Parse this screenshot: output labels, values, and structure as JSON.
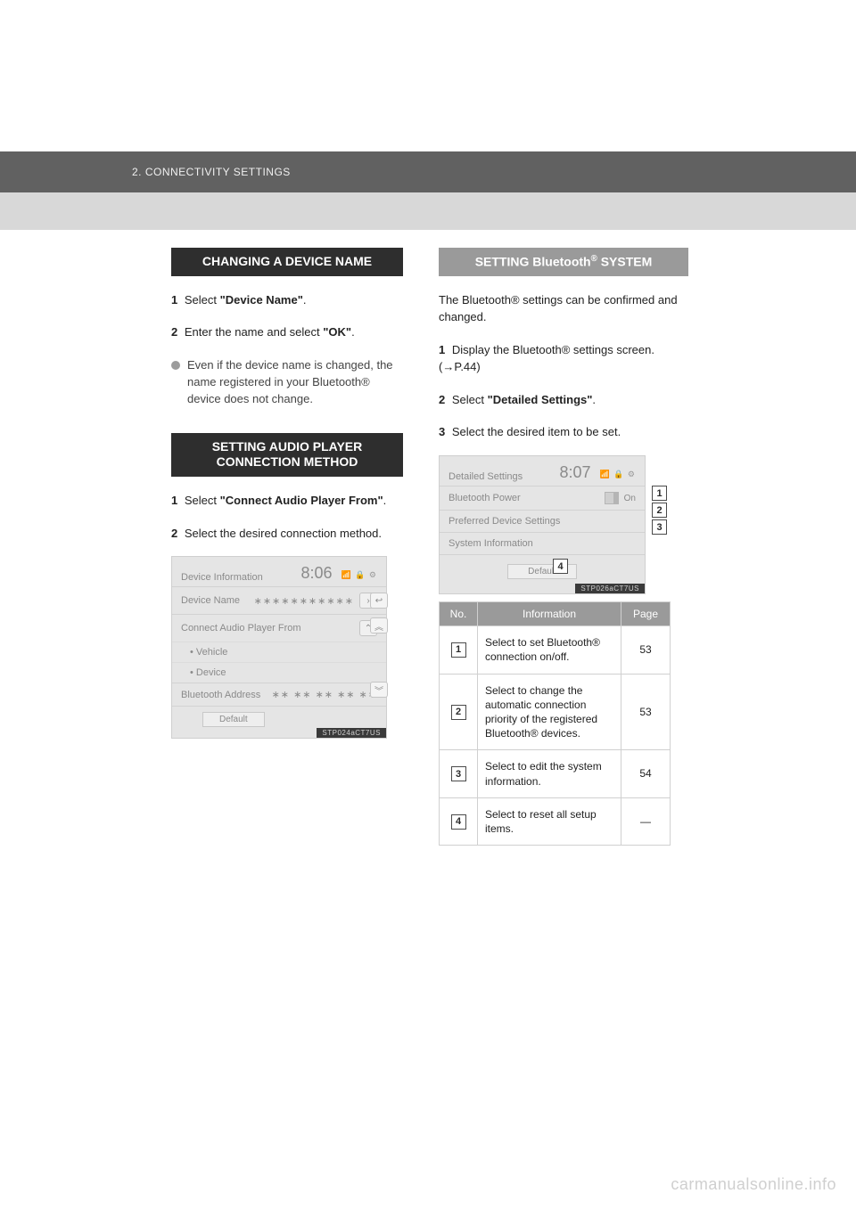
{
  "header": {
    "breadcrumb": "2. CONNECTIVITY SETTINGS"
  },
  "left": {
    "section_a_title": "CHANGING A DEVICE NAME",
    "step1": {
      "num": "1",
      "lead": "Select ",
      "quoted": "\"Device Name\"",
      "trail": "."
    },
    "step2": {
      "num": "2",
      "lead": "Enter the name and select ",
      "quoted": "\"OK\"",
      "trail": "."
    },
    "info_bullet": "Even if the device name is changed, the name registered in your Bluetooth® device does not change.",
    "section_b_title": "SETTING AUDIO PLAYER CONNECTION METHOD",
    "b_step1": {
      "num": "1",
      "lead": "Select ",
      "quoted": "\"Connect Audio Player From\"",
      "trail": "."
    },
    "b_step2": {
      "num": "2",
      "lead": "Select the desired connection method."
    },
    "screen_left": {
      "title": "Device Information",
      "time": "8:06",
      "status_icons": "📶 🔒 ⚙",
      "row_device_name": {
        "label": "Device Name",
        "value": "∗∗∗∗∗∗∗∗∗∗∗",
        "chev": "›"
      },
      "row_connect_from": {
        "label": "Connect Audio Player From",
        "chev": "⌃"
      },
      "sub_vehicle": "Vehicle",
      "sub_device": "Device",
      "row_bt_addr": {
        "label": "Bluetooth Address",
        "value": "∗∗ ∗∗ ∗∗ ∗∗ ∗∗"
      },
      "default_label": "Default",
      "back_icon": "↩",
      "up_dbl": "︽",
      "down_dbl": "︾",
      "tag": "STP024aCT7US"
    }
  },
  "right": {
    "section_title_pre": "SETTING Bluetooth",
    "section_title_sup": "®",
    "section_title_post": " SYSTEM",
    "intro": "The Bluetooth® settings can be confirmed and changed.",
    "step1": {
      "num": "1",
      "lead": "Display the Bluetooth® settings screen. (→P.44)"
    },
    "step2": {
      "num": "2",
      "lead": "Select ",
      "quoted": "\"Detailed Settings\"",
      "trail": "."
    },
    "step3": {
      "num": "3",
      "lead": "Select the desired item to be set."
    },
    "screen_right": {
      "title": "Detailed Settings",
      "time": "8:07",
      "status_icons": "📶 🔒 ⚙",
      "row_bt_power": {
        "label": "Bluetooth Power",
        "value": "On"
      },
      "row_pref": {
        "label": "Preferred Device Settings"
      },
      "row_sysinfo": {
        "label": "System Information"
      },
      "default_label": "Default",
      "tag": "STP026aCT7US",
      "callouts": {
        "c1": "1",
        "c2": "2",
        "c3": "3",
        "c4": "4"
      }
    },
    "table": {
      "h_no": "No.",
      "h_info": "Information",
      "h_page": "Page",
      "rows": [
        {
          "no": "1",
          "info": "Select to set Bluetooth® connection on/off.",
          "page": "53"
        },
        {
          "no": "2",
          "info": "Select to change the automatic connection priority of the registered Bluetooth® devices.",
          "page": "53"
        },
        {
          "no": "3",
          "info": "Select to edit the system information.",
          "page": "54"
        },
        {
          "no": "4",
          "info": "Select to reset all setup items.",
          "page": "—"
        }
      ]
    }
  },
  "watermark": "carmanualsonline.info"
}
